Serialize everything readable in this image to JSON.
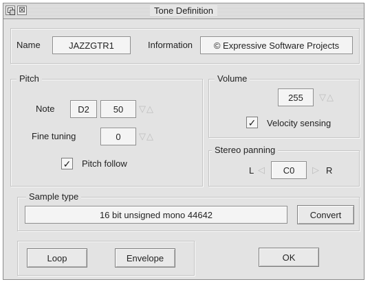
{
  "window": {
    "title": "Tone Definition",
    "back_icon": "window-back-icon",
    "close_icon": "window-close-icon",
    "close_glyph": "⊠"
  },
  "name": {
    "label": "Name",
    "value": "JAZZGTR1"
  },
  "information": {
    "label": "Information",
    "value": "© Expressive Software Projects"
  },
  "pitch": {
    "group_label": "Pitch",
    "note_label": "Note",
    "note_name": "D2",
    "note_value": "50",
    "note_arrows": "▽△",
    "fine_label": "Fine tuning",
    "fine_value": "0",
    "fine_arrows": "▽△",
    "pitch_follow_label": "Pitch follow",
    "pitch_follow_checked": true,
    "check_glyph": "✓"
  },
  "volume": {
    "group_label": "Volume",
    "value": "255",
    "arrows": "▽△",
    "velocity_label": "Velocity sensing",
    "velocity_checked": true,
    "check_glyph": "✓"
  },
  "stereo": {
    "group_label": "Stereo panning",
    "left_label": "L",
    "left_arrow": "◁",
    "value": "C0",
    "right_arrow": "▷",
    "right_label": "R"
  },
  "sample": {
    "group_label": "Sample type",
    "value": "16 bit unsigned mono 44642",
    "convert_label": "Convert"
  },
  "buttons": {
    "loop": "Loop",
    "envelope": "Envelope",
    "ok": "OK"
  }
}
